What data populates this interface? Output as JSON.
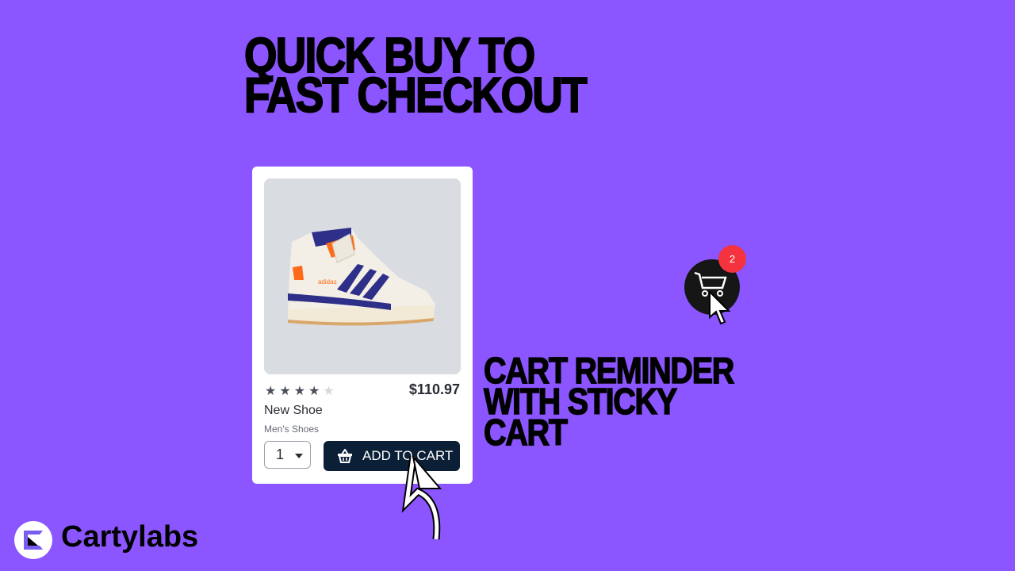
{
  "headline": {
    "line1": "QUICK BUY TO",
    "line2": "FAST CHECKOUT"
  },
  "product": {
    "rating": 4,
    "rating_max": 5,
    "price": "$110.97",
    "name": "New Shoe",
    "category": "Men's Shoes",
    "quantity": "1",
    "add_to_cart_label": "ADD TO CART"
  },
  "feature": {
    "line1": "CART REMINDER",
    "line2": "WITH STICKY",
    "line3": "CART"
  },
  "sticky_cart": {
    "badge_count": "2",
    "badge_color": "#f5333f"
  },
  "brand": {
    "name": "Cartylabs"
  },
  "colors": {
    "background": "#8b55ff",
    "button": "#0b2037"
  }
}
